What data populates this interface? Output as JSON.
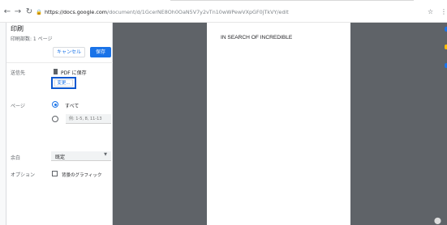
{
  "browser": {
    "back_icon": "←",
    "forward_icon": "→",
    "reload_icon": "↻",
    "lock_icon": "🔒",
    "url_host": "https://docs.google.com",
    "url_path": "/document/d/1GcerNE8Oh0OaN5V7y2vTn10wWPewVXpGF0jTkVY/edit",
    "bookmark_icon": "☆",
    "menu_icon": "⋮"
  },
  "print_panel": {
    "title": "印刷",
    "sheet_count": "印刷部数: 1 ページ",
    "cancel_label": "キャンセル",
    "save_label": "保存",
    "destination": {
      "label": "送信先",
      "value": "PDF に保存",
      "change_label": "変更..."
    },
    "pages": {
      "label": "ページ",
      "all_label": "すべて",
      "range_placeholder": "例: 1-5, 8, 11-13"
    },
    "color": {
      "label": "余白",
      "value": "既定",
      "arrow": "▼"
    },
    "options": {
      "label": "オプション",
      "background_label": "背景のグラフィック"
    }
  },
  "preview": {
    "document_text": "IN SEARCH OF INCREDIBLE"
  },
  "colors": {
    "accent": "#1a73e8",
    "focus": "#0b57d0",
    "preview_bg": "#5f6368"
  }
}
